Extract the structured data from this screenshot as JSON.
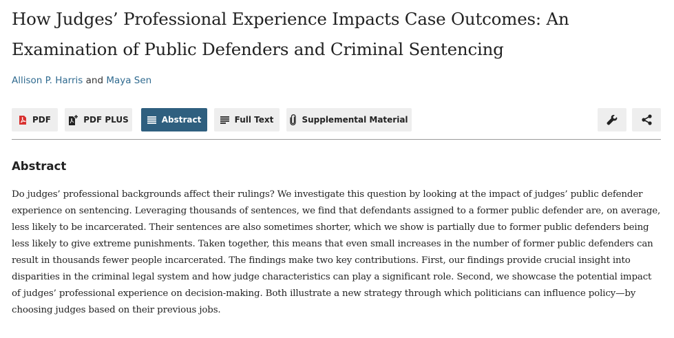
{
  "article": {
    "title_line1": "How Judges’ Professional Experience Impacts Case Outcomes: An",
    "title_line2": "Examination of Public Defenders and Criminal Sentencing",
    "authors": [
      {
        "name": "Allison P. Harris"
      },
      {
        "name": "Maya Sen"
      }
    ],
    "author_separator": "and"
  },
  "toolbar": {
    "pdf_label": "PDF",
    "pdf_plus_label": "PDF PLUS",
    "abstract_label": "Abstract",
    "fulltext_label": "Full Text",
    "supplemental_label": "Supplemental Material",
    "active_tab": "Abstract",
    "icons": {
      "pdf": "pdf-icon",
      "pdf_plus": "pdf-plus-icon",
      "abstract": "lines-icon",
      "fulltext": "text-lines-icon",
      "supplemental": "paperclip-icon",
      "tools": "wrench-icon",
      "share": "share-icon"
    },
    "colors": {
      "active_bg": "#2f5f7f",
      "button_bg": "#eeeeee",
      "pdf_red": "#d8302f",
      "link": "#2f6a8f"
    }
  },
  "abstract": {
    "heading": "Abstract",
    "text": "Do judges’ professional backgrounds affect their rulings? We investigate this question by looking at the impact of judges’ public defender experience on sentencing. Leveraging thousands of sentences, we find that defendants assigned to a former public defender are, on average, less likely to be incarcerated. Their sentences are also sometimes shorter, which we show is partially due to former public defenders being less likely to give extreme punishments. Taken together, this means that even small increases in the number of former public defenders can result in thousands fewer people incarcerated. The findings make two key contributions. First, our findings provide crucial insight into disparities in the criminal legal system and how judge characteristics can play a significant role. Second, we showcase the potential impact of judges’ professional experience on decision-making. Both illustrate a new strategy through which politicians can influence policy—by choosing judges based on their previous jobs."
  }
}
